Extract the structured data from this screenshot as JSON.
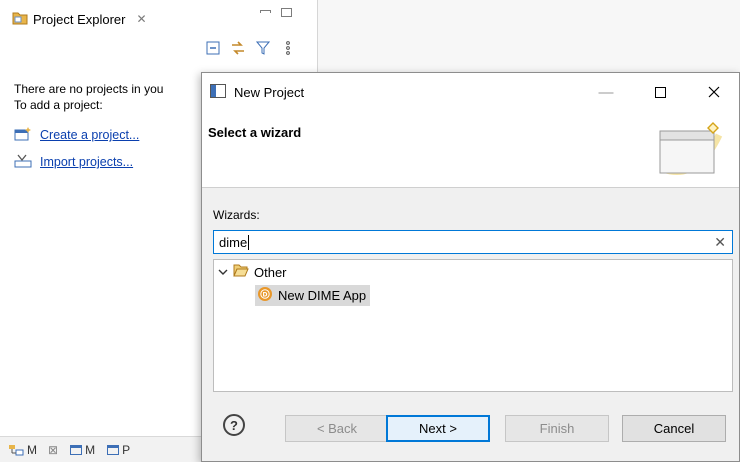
{
  "explorer": {
    "tab_label": "Project Explorer",
    "tab_close": "✕",
    "empty_line1": "There are no projects in you",
    "empty_line2": "To add a project:",
    "create_link": "Create a project...",
    "import_link": "Import projects..."
  },
  "bottom_tabs": [
    "M",
    "M",
    "P"
  ],
  "dialog": {
    "title": "New Project",
    "header_title": "Select a wizard",
    "wizards_label": "Wizards:",
    "filter_value": "dime",
    "tree": {
      "category": "Other",
      "item": "New DIME App"
    },
    "buttons": {
      "back": "< Back",
      "next": "Next >",
      "finish": "Finish",
      "cancel": "Cancel",
      "help": "?"
    }
  },
  "colors": {
    "accent": "#0078d7",
    "link": "#0a3fae",
    "dime_icon": "#e8972a"
  }
}
